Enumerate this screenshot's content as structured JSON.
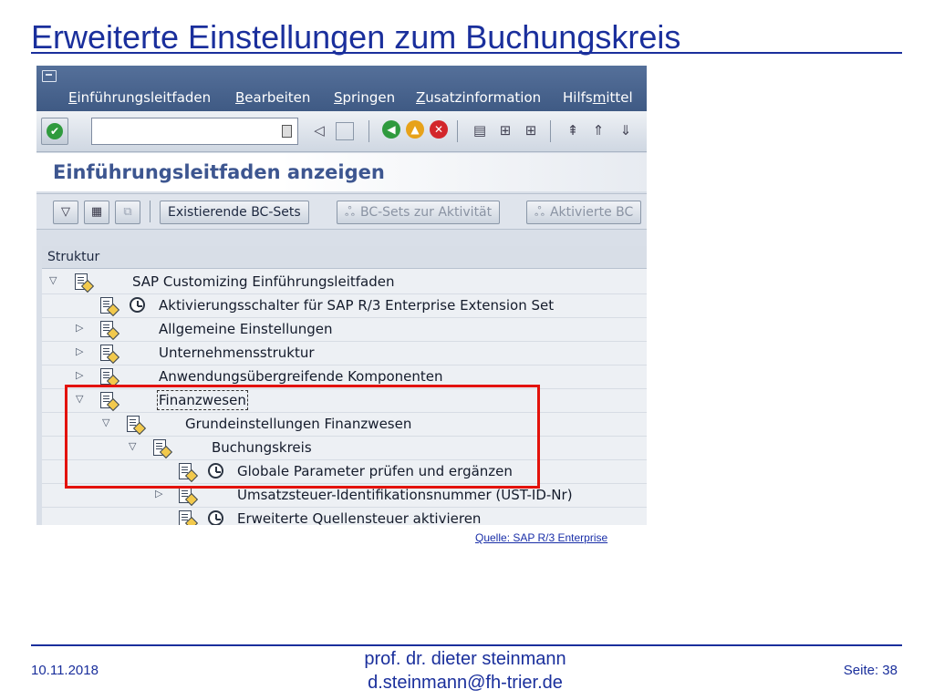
{
  "slide": {
    "title": "Erweiterte Einstellungen zum Buchungskreis",
    "source_label": "Quelle: SAP R/3 Enterprise",
    "footer": {
      "date": "10.11.2018",
      "author_line1": "prof. dr. dieter steinmann",
      "author_line2": "d.steinmann@fh-trier.de",
      "page": "Seite: 38"
    },
    "colors": {
      "accent": "#1a2f9c",
      "highlight": "#e3120b"
    }
  },
  "sap": {
    "menu": [
      {
        "mnemonic": "E",
        "rest": "inführungsleitfaden"
      },
      {
        "mnemonic": "B",
        "rest": "earbeiten"
      },
      {
        "mnemonic": "S",
        "rest": "pringen"
      },
      {
        "mnemonic": "Z",
        "rest": "usatzinformation"
      },
      {
        "before": "Hilfs",
        "mnemonic": "m",
        "rest": "ittel"
      }
    ],
    "screen_title": "Einführungsleitfaden anzeigen",
    "app_toolbar": {
      "btn1": "Existierende BC-Sets",
      "btn2": "BC-Sets zur Aktivität",
      "btn3": "Aktivierte BC"
    },
    "tree": {
      "header": "Struktur",
      "rows": [
        {
          "label": "SAP Customizing Einführungsleitfaden"
        },
        {
          "label": "Aktivierungsschalter für SAP R/3 Enterprise Extension Set"
        },
        {
          "label": "Allgemeine Einstellungen"
        },
        {
          "label": "Unternehmensstruktur"
        },
        {
          "label": "Anwendungsübergreifende Komponenten"
        },
        {
          "label": "Finanzwesen"
        },
        {
          "label": "Grundeinstellungen Finanzwesen"
        },
        {
          "label": "Buchungskreis"
        },
        {
          "label": "Globale Parameter prüfen und ergänzen"
        },
        {
          "label": "Umsatzsteuer-Identifikationsnummer (UST-ID-Nr)"
        },
        {
          "label": "Erweiterte Quellensteuer aktivieren"
        }
      ]
    }
  }
}
